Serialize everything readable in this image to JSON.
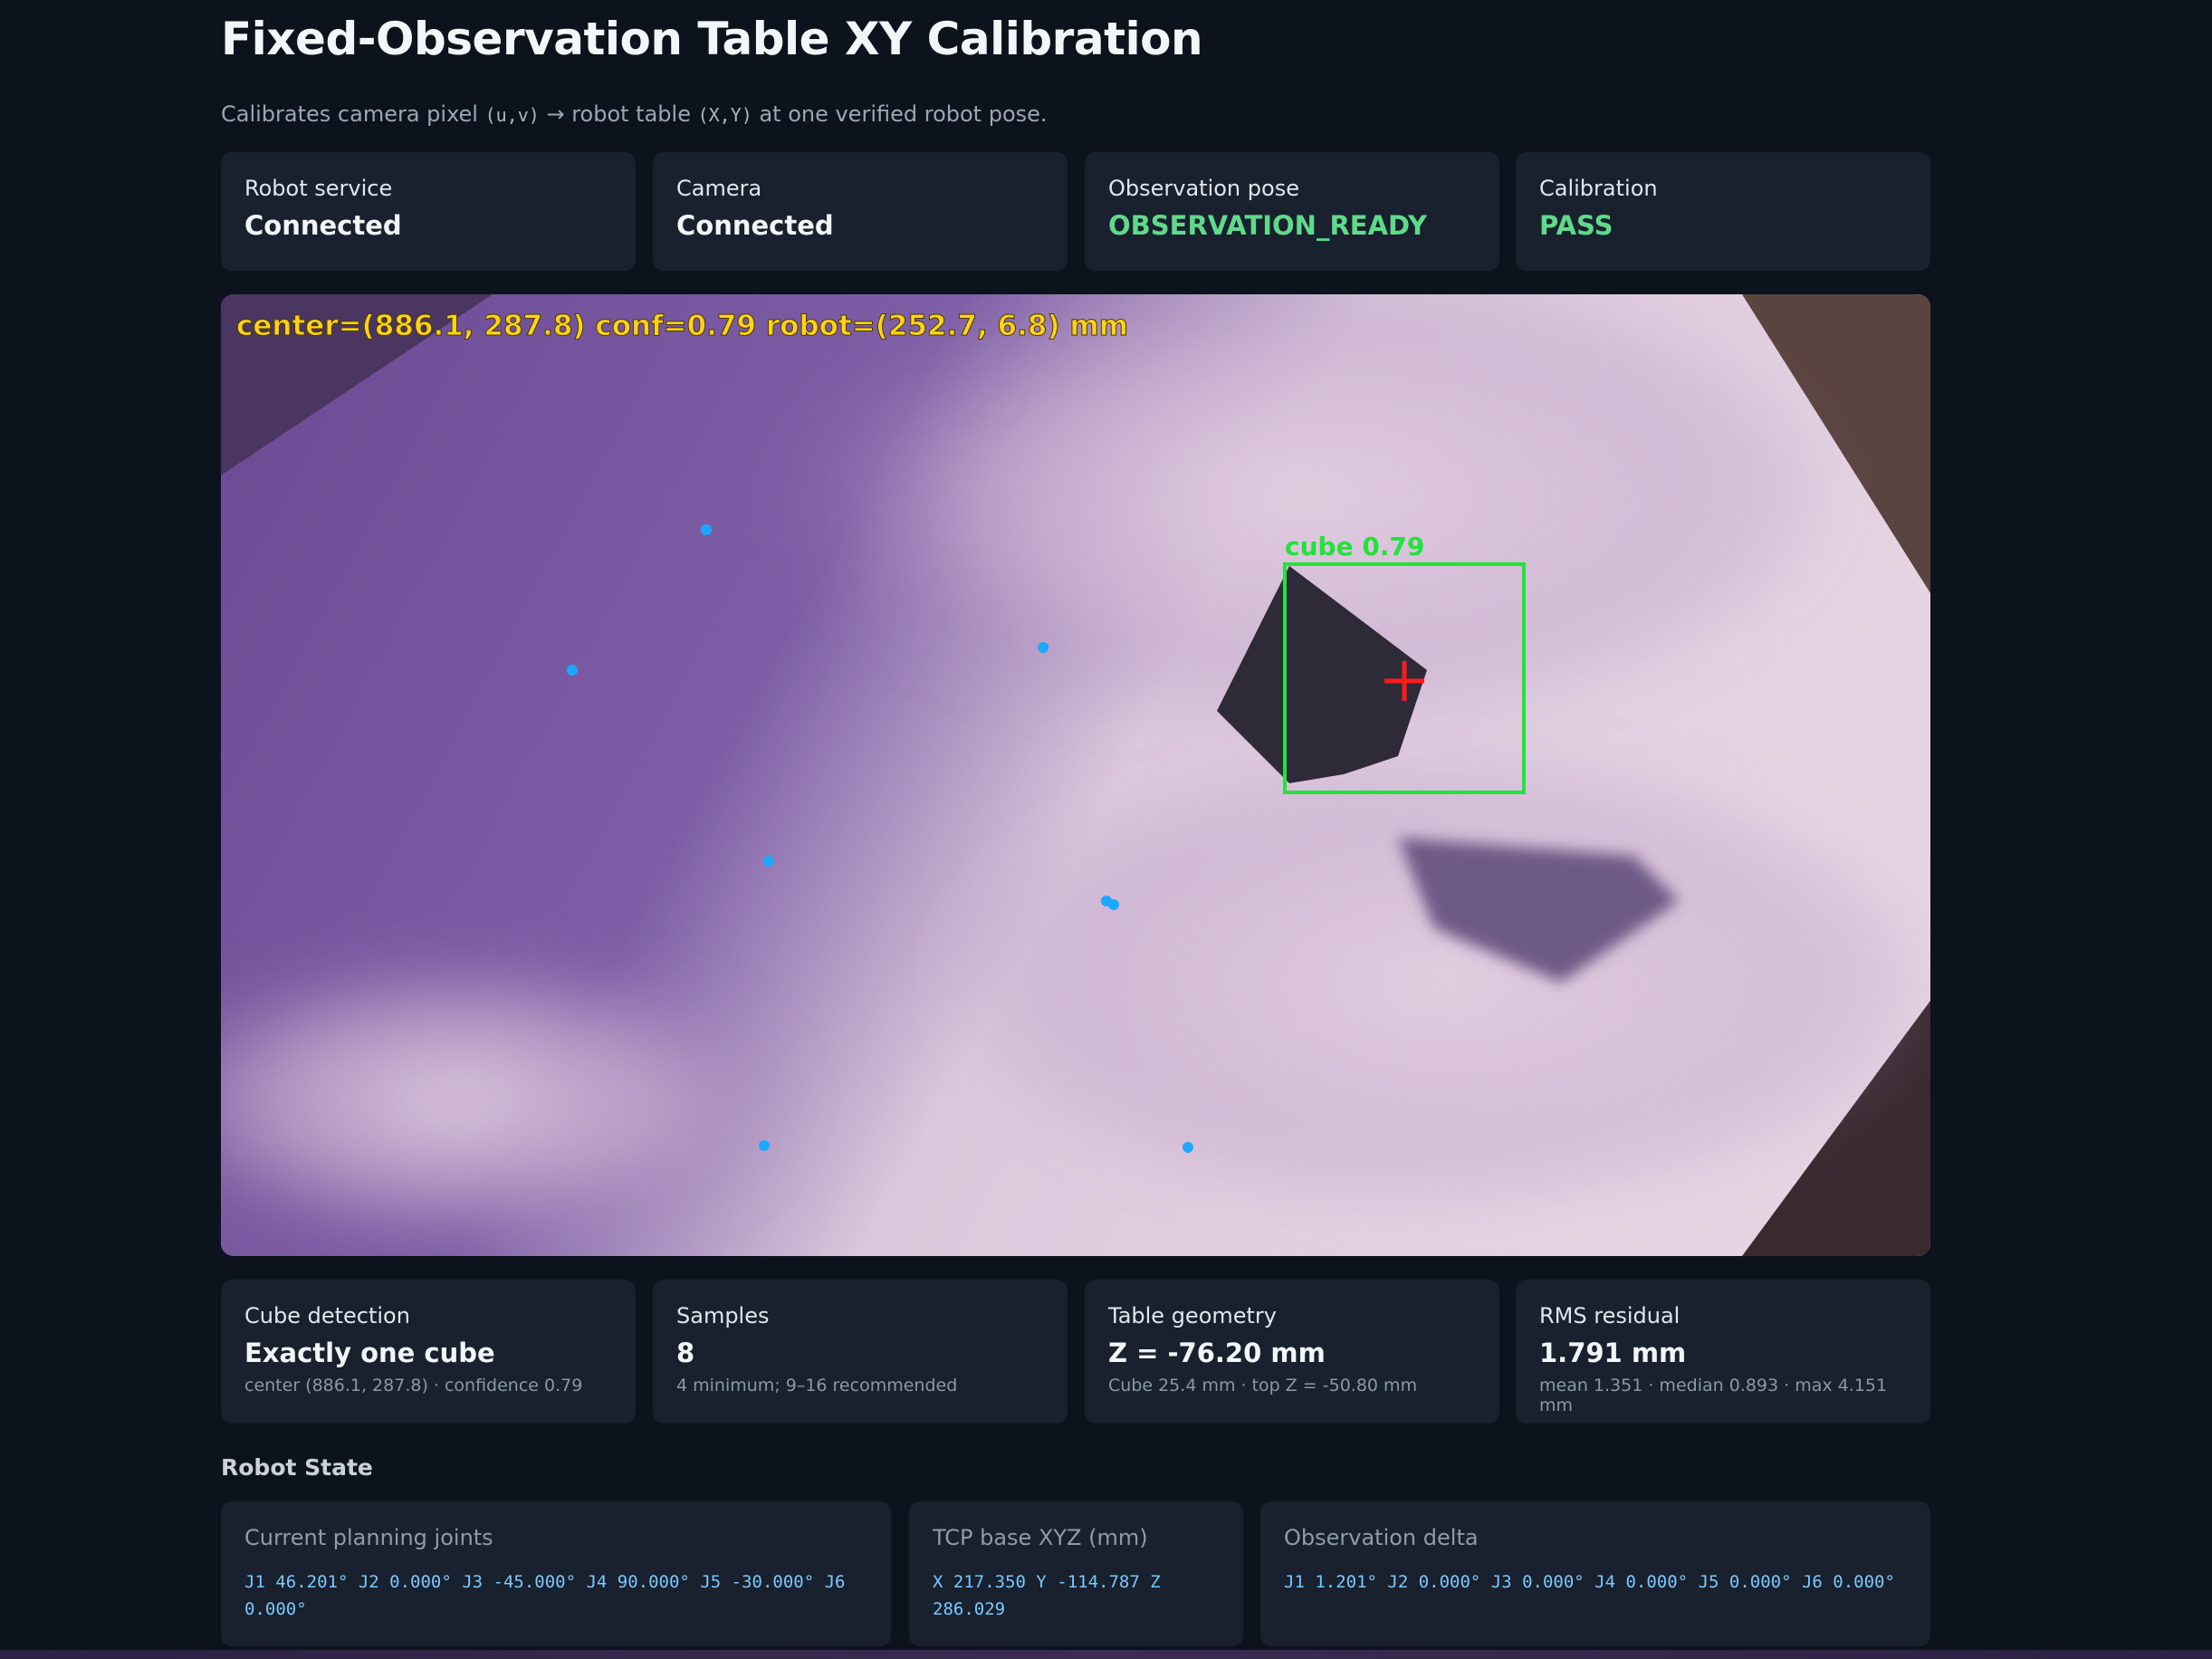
{
  "header": {
    "title": "Fixed-Observation Table XY Calibration",
    "subtitle_pre": "Calibrates camera pixel ",
    "subtitle_uv": "(u,v)",
    "subtitle_mid": " → robot table ",
    "subtitle_xy": "(X,Y)",
    "subtitle_post": " at one verified robot pose."
  },
  "status": {
    "robot_service": {
      "label": "Robot service",
      "value": "Connected"
    },
    "camera": {
      "label": "Camera",
      "value": "Connected"
    },
    "observation_pose": {
      "label": "Observation pose",
      "value": "OBSERVATION_READY"
    },
    "calibration": {
      "label": "Calibration",
      "value": "PASS"
    }
  },
  "overlay": {
    "info_text": "center=(886.1, 287.8) conf=0.79 robot=(252.7, 6.8) mm",
    "detection_label": "cube 0.79",
    "info_color": "#ffd21a",
    "box_color": "#22e33a",
    "marker_color": "#ff1a1a",
    "sample_color": "#1ca8ff"
  },
  "metrics": {
    "cube_detection": {
      "label": "Cube detection",
      "value": "Exactly one cube",
      "sub": "center (886.1, 287.8) · confidence 0.79"
    },
    "samples": {
      "label": "Samples",
      "value": "8",
      "sub": "4 minimum; 9–16 recommended"
    },
    "table_geometry": {
      "label": "Table geometry",
      "value": "Z = -76.20 mm",
      "sub": "Cube 25.4 mm · top Z = -50.80 mm"
    },
    "rms_residual": {
      "label": "RMS residual",
      "value": "1.791 mm",
      "sub": "mean 1.351 · median 0.893 · max 4.151 mm"
    }
  },
  "robot_state": {
    "title": "Robot State",
    "planning_joints": {
      "label": "Current planning joints",
      "value": "J1 46.201° J2 0.000° J3 -45.000° J4 90.000° J5 -30.000° J6 0.000°"
    },
    "tcp_xyz": {
      "label": "TCP base XYZ (mm)",
      "value": "X 217.350 Y -114.787 Z 286.029"
    },
    "observation_delta": {
      "label": "Observation delta",
      "value": "J1 1.201° J2 0.000° J3 0.000° J4 0.000° J5 0.000° J6 0.000°"
    }
  }
}
